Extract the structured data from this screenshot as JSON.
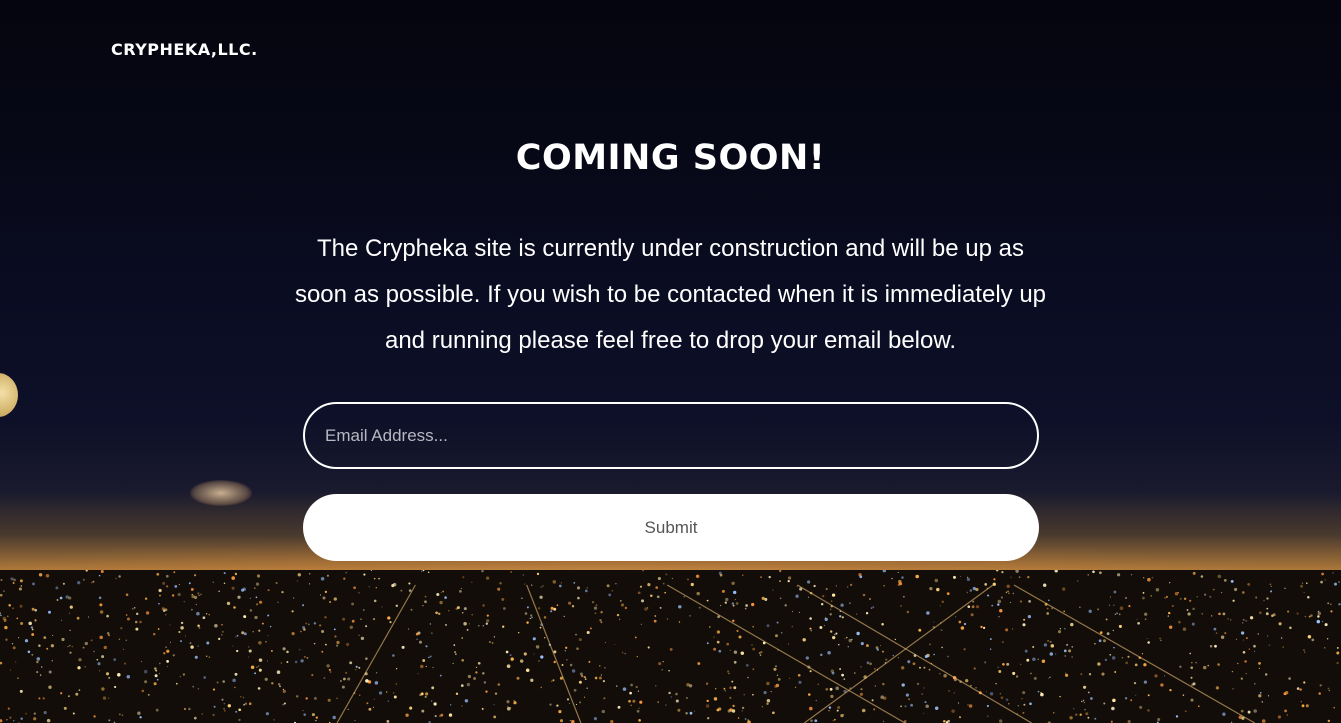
{
  "brand": {
    "logo_text": "CRYPHEKA,LLC."
  },
  "hero": {
    "headline": "COMING SOON!",
    "intro": "The Crypheka site is currently under construction and will be up as soon as possible. If you wish to be contacted when it is immediately up and running please feel free to drop your email below."
  },
  "signup_form": {
    "email_placeholder": "Email Address...",
    "email_value": "",
    "submit_label": "Submit"
  },
  "colors": {
    "text": "#ffffff",
    "button_bg": "#ffffff",
    "button_text": "#555555",
    "sky": "#070816",
    "city_glow": "#ffbe6e"
  }
}
